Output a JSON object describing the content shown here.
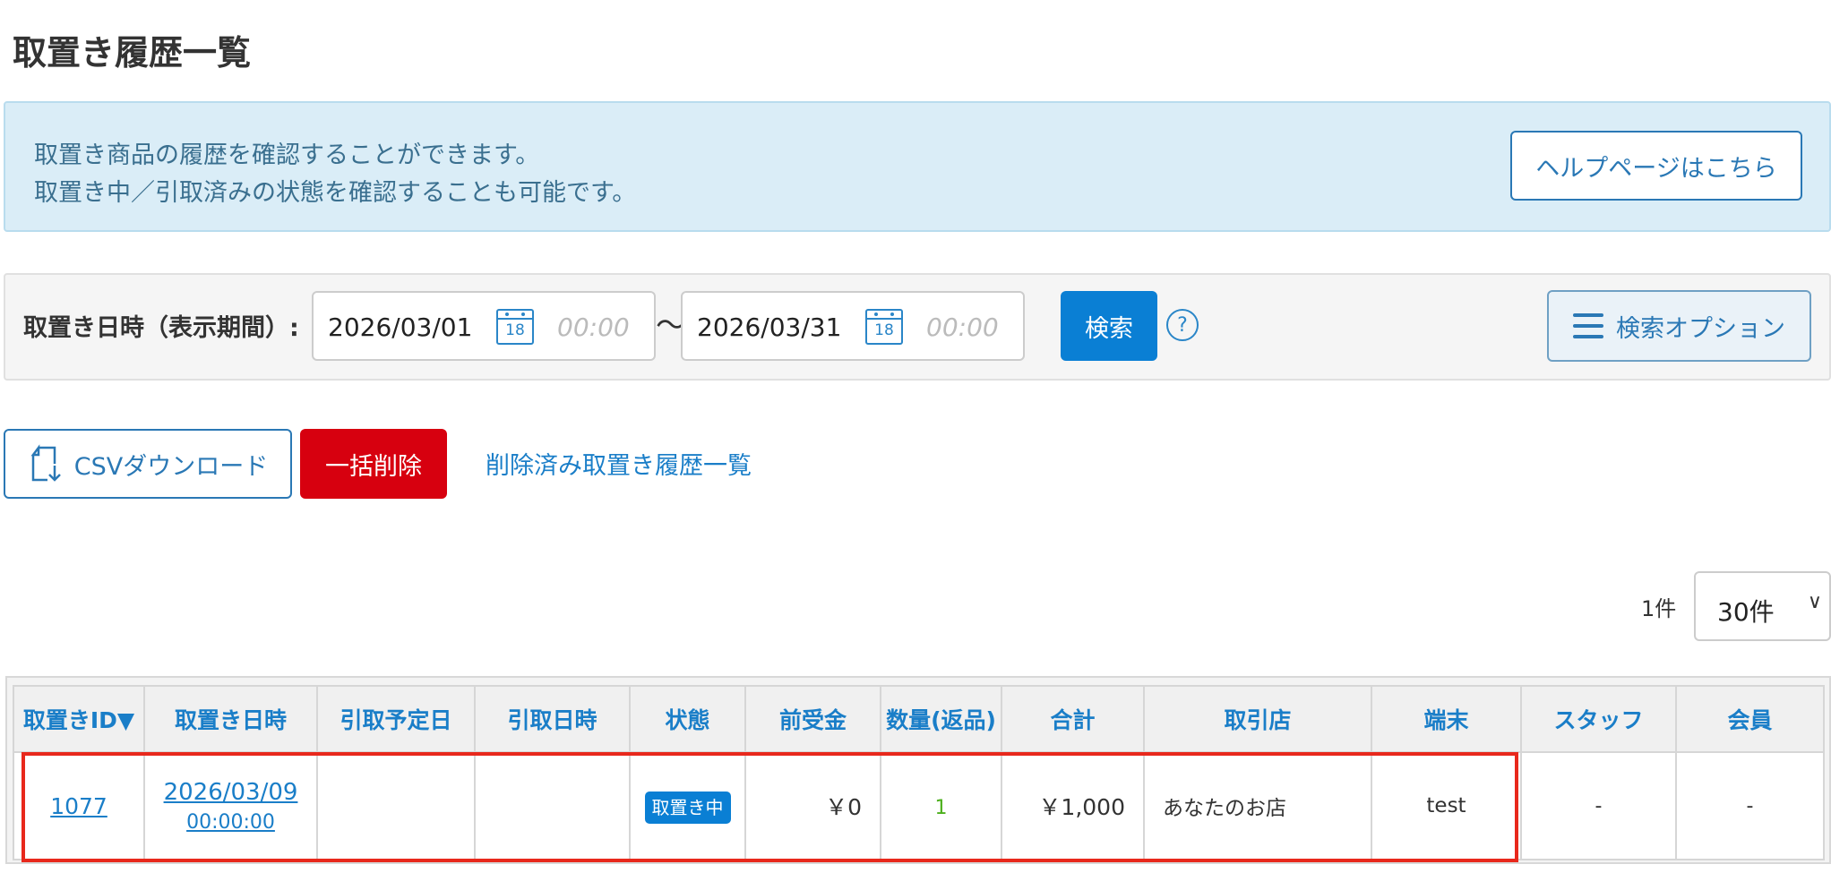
{
  "page": {
    "title": "取置き履歴一覧"
  },
  "info": {
    "line1": "取置き商品の履歴を確認することができます。",
    "line2": "取置き中／引取済みの状態を確認することも可能です。",
    "help_label": "ヘルプページはこちら"
  },
  "search": {
    "label": "取置き日時（表示期間）:",
    "from_date": "2026/03/01",
    "from_time_placeholder": "00:00",
    "to_date": "2026/03/31",
    "to_time_placeholder": "00:00",
    "calendar_day": "18",
    "separator": "〜",
    "submit_label": "検索",
    "help_icon": "?",
    "options_label": "検索オプション"
  },
  "actions": {
    "csv_label": "CSVダウンロード",
    "bulk_delete_label": "一括削除",
    "deleted_link_label": "削除済み取置き履歴一覧"
  },
  "pagination": {
    "count": "1件",
    "per_page": "30件"
  },
  "table": {
    "columns": [
      "取置きID▼",
      "取置き日時",
      "引取予定日",
      "引取日時",
      "状態",
      "前受金",
      "数量(返品)",
      "合計",
      "取引店",
      "端末",
      "スタッフ",
      "会員"
    ],
    "rows": [
      {
        "id": "1077",
        "date": "2026/03/09",
        "time": "00:00:00",
        "pickup_planned": "",
        "pickup_at": "",
        "status": "取置き中",
        "deposit": "￥0",
        "quantity": "1",
        "total": "￥1,000",
        "store": "あなたのお店",
        "terminal": "test",
        "staff": "-",
        "member": "-"
      }
    ]
  },
  "colors": {
    "primary": "#0a7fd4",
    "link": "#1a7ec8",
    "danger": "#d7000f",
    "info_bg": "#daedf7",
    "highlight": "#e8281c"
  },
  "icons": [
    "calendar-icon",
    "help-circle-icon",
    "menu-icon",
    "csv-download-icon",
    "chevron-down-icon"
  ]
}
